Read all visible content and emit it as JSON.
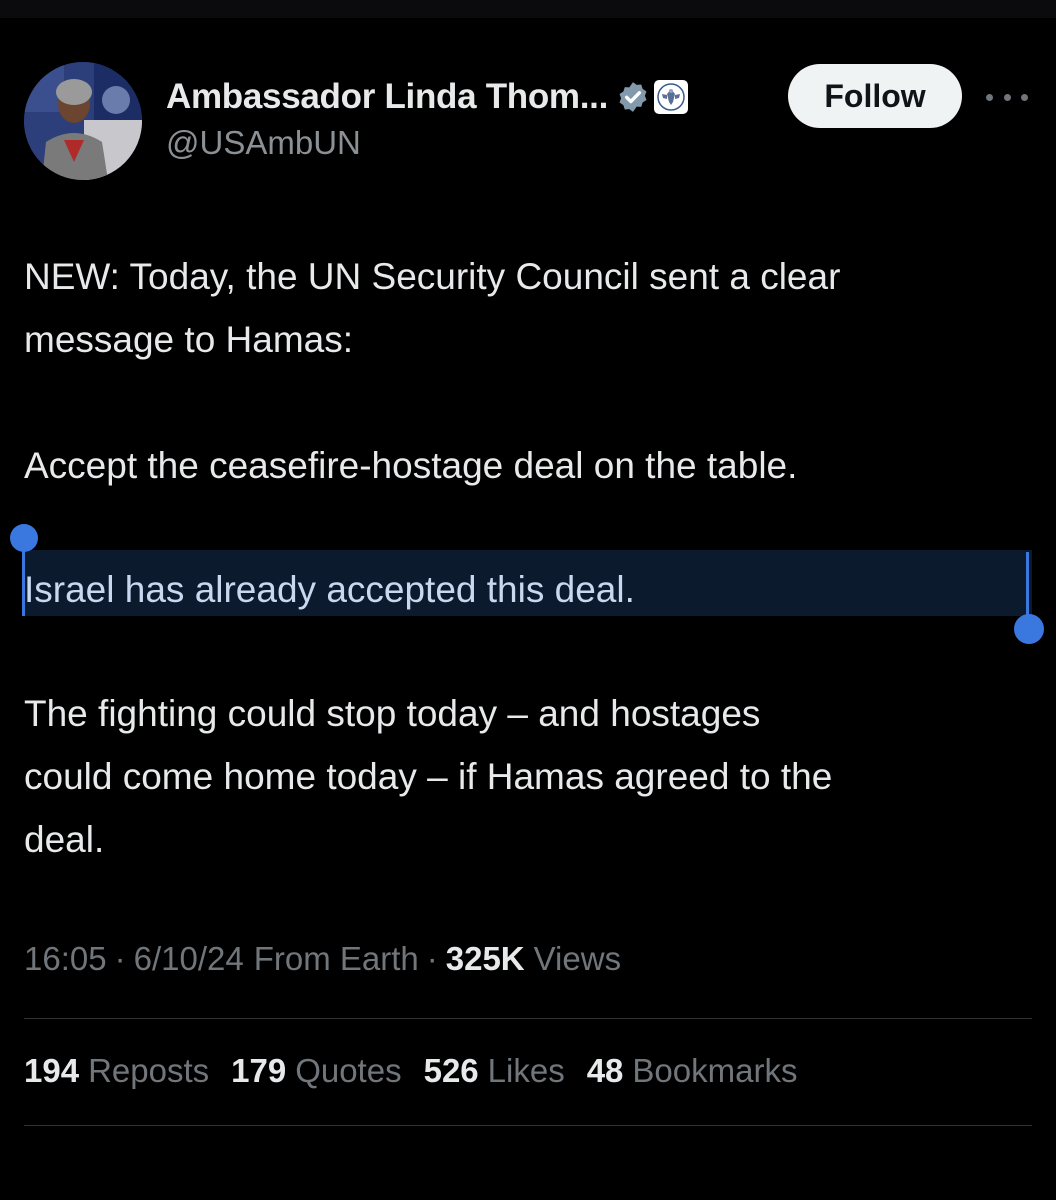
{
  "colors": {
    "background": "#000000",
    "text_primary": "#e7e9ea",
    "text_secondary": "#71767b",
    "verified_badge": "#829aab",
    "selection": "#3a78e0",
    "follow_button_bg": "#eff3f4"
  },
  "author": {
    "display_name": "Ambassador Linda Thom...",
    "handle": "@USAmbUN",
    "avatar_icon": "profile-photo",
    "verified_icon": "verified-badge-icon",
    "affiliate_icon": "us-seal-icon"
  },
  "actions": {
    "follow_label": "Follow",
    "more_icon": "more-options-icon"
  },
  "tweet": {
    "line_1": "NEW: Today, the UN Security Council sent a clear",
    "line_2": "message to Hamas:",
    "line_3": "Accept the ceasefire-hostage deal on the table.",
    "line_4_selected": "Israel has already accepted this deal.",
    "line_5": "The fighting could stop today – and hostages",
    "line_6": "could come home today – if Hamas agreed to the",
    "line_7": "deal."
  },
  "meta": {
    "time": "16:05",
    "date": "6/10/24",
    "source": "From Earth",
    "separator": "·",
    "views_count": "325K",
    "views_label": "Views"
  },
  "stats": [
    {
      "count": "194",
      "label": "Reposts"
    },
    {
      "count": "179",
      "label": "Quotes"
    },
    {
      "count": "526",
      "label": "Likes"
    },
    {
      "count": "48",
      "label": "Bookmarks"
    }
  ]
}
